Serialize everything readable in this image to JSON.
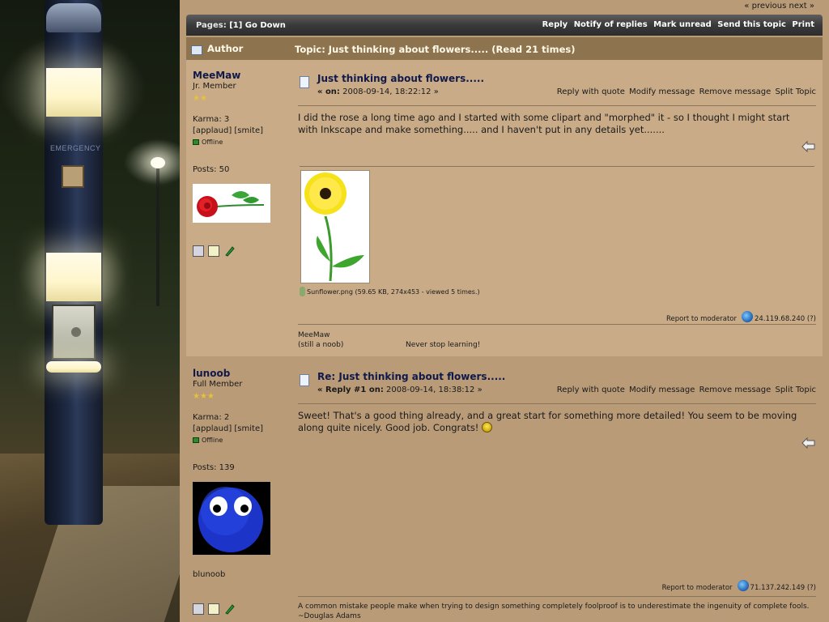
{
  "nav": {
    "prev": "« previous",
    "next": "next »"
  },
  "pagebar": {
    "pages_label": "Pages:",
    "pages_current": "[1]",
    "go_down": "Go Down",
    "actions": [
      "Reply",
      "Notify of replies",
      "Mark unread",
      "Send this topic",
      "Print"
    ]
  },
  "header": {
    "author": "Author",
    "topic": "Topic: Just thinking about flowers.....  (Read 21 times)"
  },
  "posts": [
    {
      "author": "MeeMaw",
      "rank": "Jr. Member",
      "stars": "★★",
      "karma": "Karma: 3",
      "applaud_smite": "[applaud] [smite]",
      "online_status": "Offline",
      "post_count": "Posts: 50",
      "subject": "Just thinking about flowers.....",
      "date_prefix": "« on:",
      "date": "2008-09-14, 18:22:12 »",
      "actions": [
        "Reply with quote",
        "Modify message",
        "Remove message",
        "Split Topic"
      ],
      "body": "I did the rose a long time ago and I started with some clipart and \"morphed\" it - so I thought I might start with Inkscape and make something.....   and I haven't put in any details yet.......",
      "attachment": "Sunflower.png (59.65 KB, 274x453 - viewed 5 times.)",
      "report": "Report to moderator",
      "ip": "24.119.68.240 (?)",
      "sig_line1": "MeeMaw",
      "sig_line2_left": "(still a noob)",
      "sig_line2_right": "Never stop learning!"
    },
    {
      "author": "lunoob",
      "rank": "Full Member",
      "stars": "★★★",
      "karma": "Karma: 2",
      "applaud_smite": "[applaud] [smite]",
      "online_status": "Offline",
      "post_count": "Posts: 139",
      "personal_text": "blunoob",
      "subject": "Re: Just thinking about flowers.....",
      "date_prefix": "« Reply #1 on:",
      "date": "2008-09-14, 18:38:12 »",
      "actions": [
        "Reply with quote",
        "Modify message",
        "Remove message",
        "Split Topic"
      ],
      "body": "Sweet!  That's a good thing already, and a great start for something more detailed!  You seem to be moving along quite nicely.  Good job.  Congrats!",
      "report": "Report to moderator",
      "ip": "71.137.242.149 (?)",
      "sig_line1": "A common mistake people make when trying to design something completely foolproof is to underestimate the ingenuity of complete fools.",
      "sig_line2": "~Douglas Adams"
    }
  ],
  "background_photo": {
    "pole_label": "EMERGENCY"
  },
  "colors": {
    "forum_bg": "#b99b78",
    "header_bg": "#8e734f",
    "pagebar_bg": "#3a3a3a",
    "link_dark": "#101a4a"
  }
}
